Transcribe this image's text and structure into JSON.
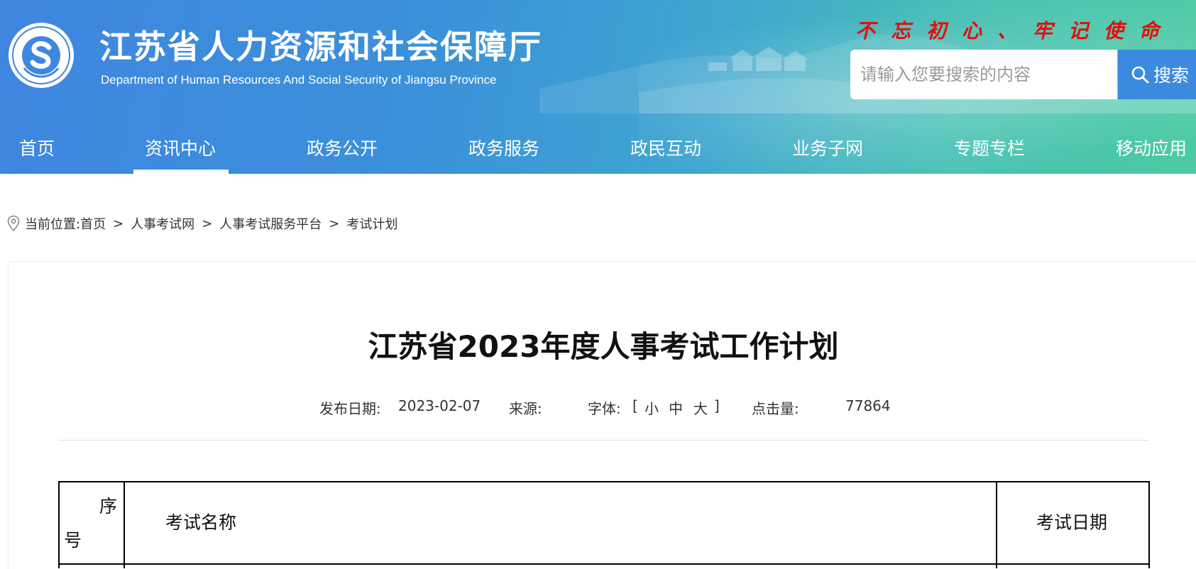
{
  "header": {
    "site_title": "江苏省人力资源和社会保障厅",
    "site_subtitle": "Department of Human Resources And Social Security of Jiangsu Province",
    "slogan": "不忘初心、牢记使命",
    "logo_icon": "hrss-emblem-icon",
    "search": {
      "placeholder": "请输入您要搜索的内容",
      "button_label": "搜索",
      "icon": "search-icon"
    },
    "colors": {
      "gradient_start": "#3f86e0",
      "gradient_end": "#4ccaa3",
      "slogan": "#e50d0d",
      "search_button": "#3a8ae0"
    }
  },
  "nav": {
    "items": [
      {
        "label": "首页"
      },
      {
        "label": "资讯中心",
        "active": true
      },
      {
        "label": "政务公开"
      },
      {
        "label": "政务服务"
      },
      {
        "label": "政民互动"
      },
      {
        "label": "业务子网"
      },
      {
        "label": "专题专栏"
      },
      {
        "label": "移动应用"
      }
    ]
  },
  "breadcrumb": {
    "icon": "location-pin-icon",
    "prefix": "当前位置:",
    "items": [
      "首页",
      "人事考试网",
      "人事考试服务平台",
      "考试计划"
    ],
    "separator": ">"
  },
  "article": {
    "title": "江苏省2023年度人事考试工作计划",
    "meta": {
      "date_label": "发布日期:",
      "date": "2023-02-07",
      "source_label": "来源:",
      "source": "",
      "font_label": "字体:",
      "font_open": "[",
      "font_small": "小",
      "font_medium": "中",
      "font_large": "大",
      "font_close": "]",
      "views_label": "点击量:",
      "views": "77864"
    },
    "table": {
      "headers": {
        "seq_part1": "序",
        "seq_part2": "号",
        "name": "考试名称",
        "date": "考试日期"
      }
    }
  }
}
